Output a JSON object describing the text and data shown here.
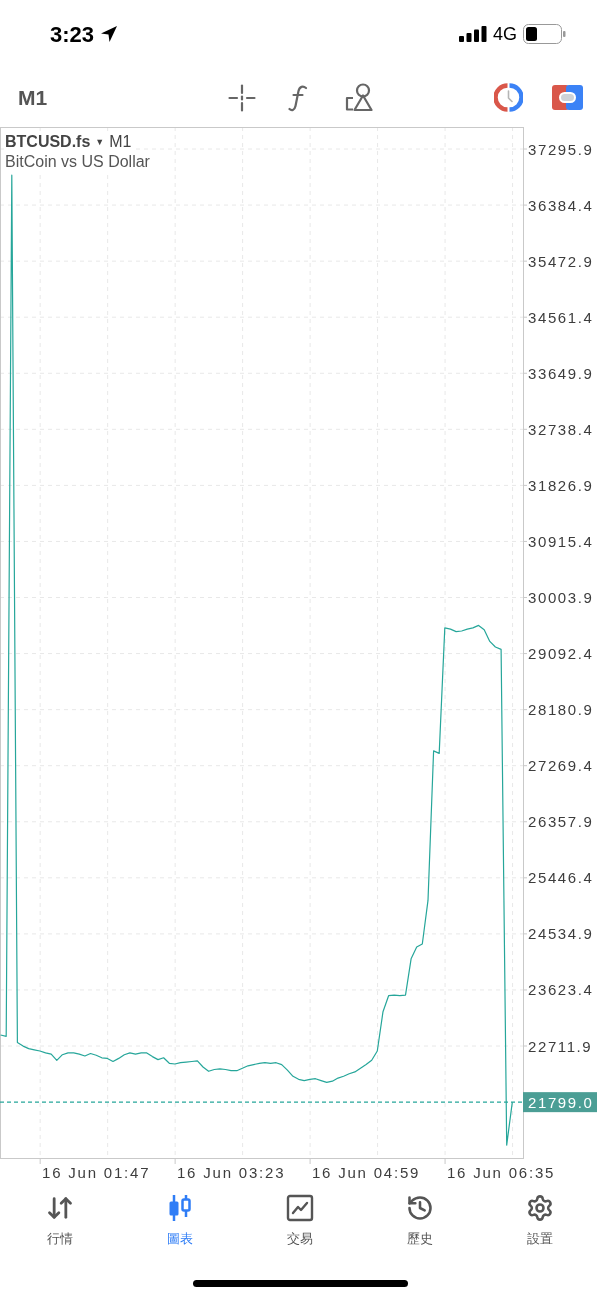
{
  "status_bar": {
    "time": "3:23",
    "network": "4G"
  },
  "toolbar": {
    "timeframe": "M1"
  },
  "chart": {
    "symbol": "BTCUSD.fs",
    "dropdown": "▼",
    "timeframe": "M1",
    "description": "BitCoin vs US Dollar",
    "chart_data": {
      "type": "line",
      "grid": true,
      "ylim": [
        20890.9,
        37653.9
      ],
      "yticks": [
        {
          "value": 37295.9,
          "label": "37295.9"
        },
        {
          "value": 36384.4,
          "label": "36384.4"
        },
        {
          "value": 35472.9,
          "label": "35472.9"
        },
        {
          "value": 34561.4,
          "label": "34561.4"
        },
        {
          "value": 33649.9,
          "label": "33649.9"
        },
        {
          "value": 32738.4,
          "label": "32738.4"
        },
        {
          "value": 31826.9,
          "label": "31826.9"
        },
        {
          "value": 30915.4,
          "label": "30915.4"
        },
        {
          "value": 30003.9,
          "label": "30003.9"
        },
        {
          "value": 29092.4,
          "label": "29092.4"
        },
        {
          "value": 28180.9,
          "label": "28180.9"
        },
        {
          "value": 27269.4,
          "label": "27269.4"
        },
        {
          "value": 26357.9,
          "label": "26357.9"
        },
        {
          "value": 25446.4,
          "label": "25446.4"
        },
        {
          "value": 24534.9,
          "label": "24534.9"
        },
        {
          "value": 23623.4,
          "label": "23623.4"
        },
        {
          "value": 22711.9,
          "label": "22711.9"
        }
      ],
      "categories": [
        null,
        null,
        null,
        null,
        null,
        null,
        null,
        null,
        null,
        null,
        null,
        null,
        null,
        null,
        null,
        null,
        null,
        "16 Jun 01:47",
        null,
        null,
        null,
        null,
        null,
        null,
        null,
        null,
        null,
        null,
        null,
        null,
        null,
        null,
        null,
        null,
        null,
        null,
        null,
        null,
        null,
        null,
        null,
        "16 Jun 03:23",
        null,
        null,
        null,
        null,
        null,
        null,
        null,
        null,
        null,
        null,
        null,
        null,
        null,
        null,
        null,
        null,
        null,
        null,
        null,
        null,
        null,
        null,
        null,
        "16 Jun 04:59",
        null,
        null,
        null,
        null,
        null,
        null,
        null,
        null,
        null,
        null,
        null,
        null,
        null,
        null,
        null,
        null,
        null,
        null,
        null,
        null,
        null,
        null,
        null,
        "16 Jun 06:35",
        null,
        null
      ],
      "series": [
        {
          "color": "#26a69a",
          "values": [
            22890,
            22870,
            36870,
            22770,
            22710,
            22670,
            22650,
            22630,
            22600,
            22580,
            22480,
            22570,
            22600,
            22600,
            22580,
            22550,
            22590,
            22560,
            22520,
            22510,
            22460,
            22510,
            22570,
            22600,
            22580,
            22600,
            22600,
            22540,
            22490,
            22520,
            22430,
            22420,
            22440,
            22450,
            22460,
            22470,
            22370,
            22300,
            22330,
            22340,
            22330,
            22310,
            22310,
            22350,
            22390,
            22410,
            22430,
            22440,
            22430,
            22440,
            22410,
            22320,
            22220,
            22170,
            22150,
            22170,
            22180,
            22150,
            22120,
            22140,
            22190,
            22220,
            22260,
            22290,
            22350,
            22410,
            22480,
            22630,
            23270,
            23530,
            23540,
            23530,
            23540,
            24130,
            24320,
            24370,
            25080,
            27510,
            27470,
            29510,
            29490,
            29450,
            29460,
            29490,
            29510,
            29550,
            29480,
            29290,
            29200,
            29160,
            21100,
            21800
          ]
        }
      ],
      "ref_lines": [
        {
          "axis": "y",
          "value": 21799.0,
          "label": "21799.0",
          "color": "#26a69a"
        }
      ]
    }
  },
  "tabs": [
    {
      "label": "行情",
      "selected": false
    },
    {
      "label": "圖表",
      "selected": true
    },
    {
      "label": "交易",
      "selected": false
    },
    {
      "label": "歷史",
      "selected": false
    },
    {
      "label": "設置",
      "selected": false
    }
  ]
}
